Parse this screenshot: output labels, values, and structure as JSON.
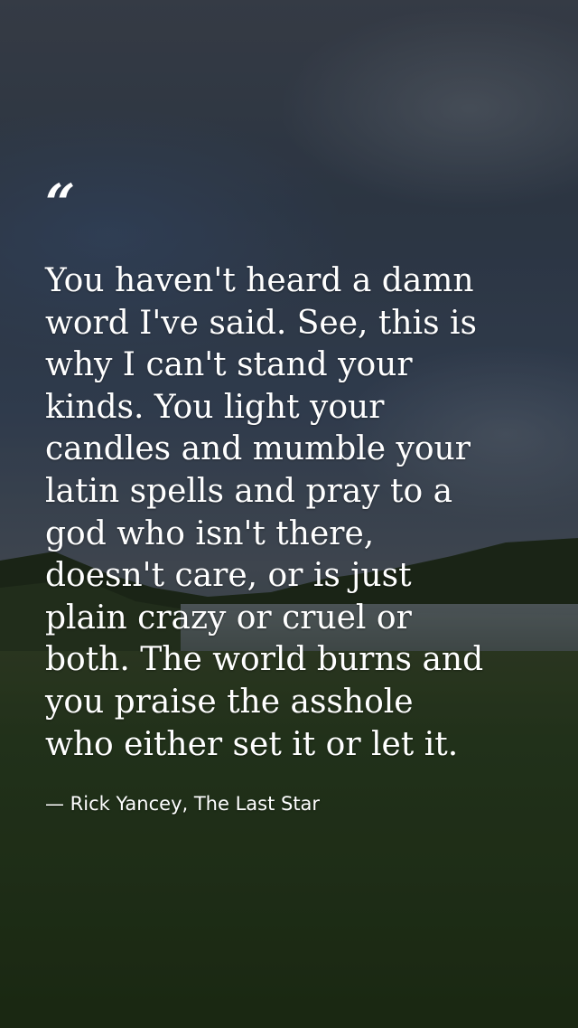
{
  "quote": {
    "open_mark": "“",
    "text": "You haven't heard a damn\nword I've said. See, this is\nwhy I can't stand your\nkinds. You light your\ncandles and mumble your\nlatin spells and pray to a\ngod who isn't there,\ndoesn't care, or is just\nplain crazy or cruel or\nboth. The world burns and\nyou praise the asshole\nwho either set it or let it.",
    "attribution": "— Rick Yancey, The Last Star"
  },
  "colors": {
    "text": "#ffffff",
    "sky": "#42526a",
    "grass": "#2a3f20"
  }
}
